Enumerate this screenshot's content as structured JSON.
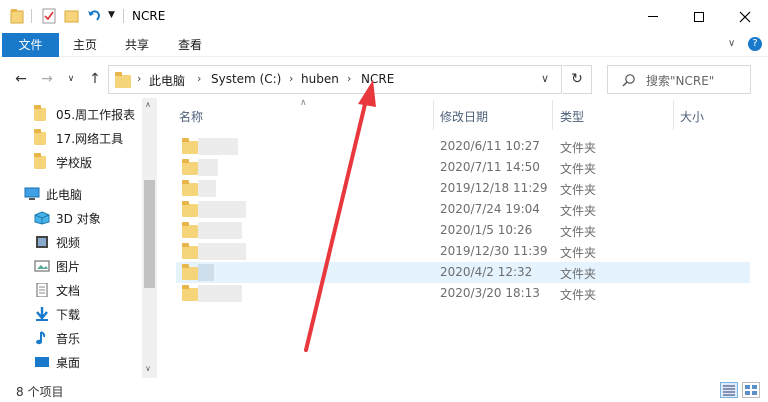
{
  "window": {
    "title": "NCRE",
    "controls": {
      "minimize": "minimize-icon",
      "maximize": "maximize-icon",
      "close": "close-icon"
    }
  },
  "ribbon": {
    "tabs": [
      {
        "label": "文件"
      },
      {
        "label": "主页"
      },
      {
        "label": "共享"
      },
      {
        "label": "查看"
      }
    ]
  },
  "address": {
    "breadcrumbs": [
      "此电脑",
      "System (C:)",
      "huben",
      "NCRE"
    ],
    "search_placeholder": "搜索\"NCRE\""
  },
  "navpane": {
    "items": [
      {
        "label": "05.周工作报表",
        "icon": "folder-icon"
      },
      {
        "label": "17.网络工具",
        "icon": "folder-icon"
      },
      {
        "label": "学校版",
        "icon": "folder-icon"
      },
      {
        "label": "此电脑",
        "icon": "computer-icon"
      },
      {
        "label": "3D 对象",
        "icon": "3d-objects-icon"
      },
      {
        "label": "视频",
        "icon": "video-icon"
      },
      {
        "label": "图片",
        "icon": "picture-icon"
      },
      {
        "label": "文档",
        "icon": "document-icon"
      },
      {
        "label": "下载",
        "icon": "download-icon"
      },
      {
        "label": "音乐",
        "icon": "music-icon"
      },
      {
        "label": "桌面",
        "icon": "desktop-icon"
      }
    ]
  },
  "content": {
    "columns": [
      "名称",
      "修改日期",
      "类型",
      "大小"
    ],
    "rows": [
      {
        "date": "2020/6/11 10:27",
        "type": "文件夹",
        "selected": false
      },
      {
        "date": "2020/7/11 14:50",
        "type": "文件夹",
        "selected": false
      },
      {
        "date": "2019/12/18 11:29",
        "type": "文件夹",
        "selected": false
      },
      {
        "date": "2020/7/24 19:04",
        "type": "文件夹",
        "selected": false
      },
      {
        "date": "2020/1/5 10:26",
        "type": "文件夹",
        "selected": false
      },
      {
        "date": "2019/12/30 11:39",
        "type": "文件夹",
        "selected": false
      },
      {
        "date": "2020/4/2 12:32",
        "type": "文件夹",
        "selected": true
      },
      {
        "date": "2020/3/20 18:13",
        "type": "文件夹",
        "selected": false
      }
    ]
  },
  "status": {
    "item_count": "8 个项目"
  },
  "colors": {
    "accent": "#1979ca",
    "annotation_arrow": "#e8383d",
    "selection": "#e5f3ff"
  }
}
